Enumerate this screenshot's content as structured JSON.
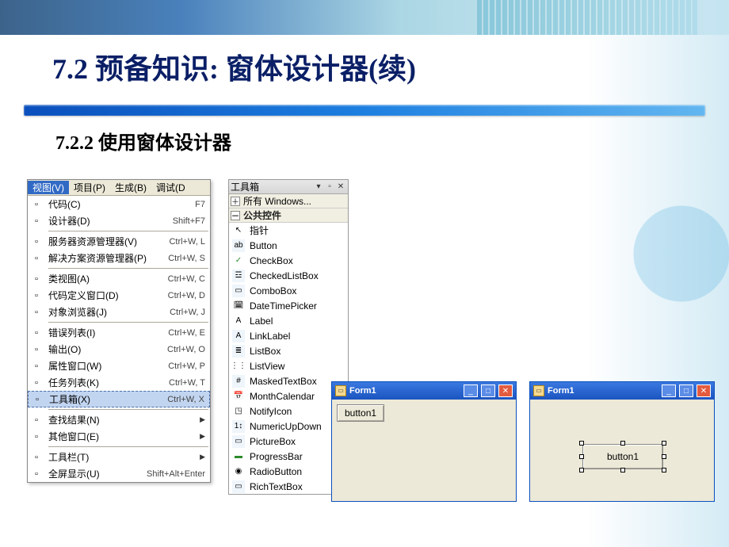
{
  "slide": {
    "title": "7.2 预备知识: 窗体设计器(续)",
    "subtitle": "7.2.2 使用窗体设计器"
  },
  "menu_bar": {
    "items": [
      "视图(V)",
      "项目(P)",
      "生成(B)",
      "调试(D"
    ],
    "active_index": 0
  },
  "view_menu": [
    {
      "icon": "code-icon",
      "label": "代码(C)",
      "shortcut": "F7"
    },
    {
      "icon": "designer-icon",
      "label": "设计器(D)",
      "shortcut": "Shift+F7"
    },
    {
      "sep": true
    },
    {
      "icon": "server-explorer-icon",
      "label": "服务器资源管理器(V)",
      "shortcut": "Ctrl+W, L"
    },
    {
      "icon": "solution-explorer-icon",
      "label": "解决方案资源管理器(P)",
      "shortcut": "Ctrl+W, S"
    },
    {
      "sep": true
    },
    {
      "icon": "class-view-icon",
      "label": "类视图(A)",
      "shortcut": "Ctrl+W, C"
    },
    {
      "icon": "code-def-icon",
      "label": "代码定义窗口(D)",
      "shortcut": "Ctrl+W, D"
    },
    {
      "icon": "object-browser-icon",
      "label": "对象浏览器(J)",
      "shortcut": "Ctrl+W, J"
    },
    {
      "sep": true
    },
    {
      "icon": "error-list-icon",
      "label": "错误列表(I)",
      "shortcut": "Ctrl+W, E"
    },
    {
      "icon": "output-icon",
      "label": "输出(O)",
      "shortcut": "Ctrl+W, O"
    },
    {
      "icon": "properties-icon",
      "label": "属性窗口(W)",
      "shortcut": "Ctrl+W, P"
    },
    {
      "icon": "task-list-icon",
      "label": "任务列表(K)",
      "shortcut": "Ctrl+W, T"
    },
    {
      "icon": "toolbox-icon",
      "label": "工具箱(X)",
      "shortcut": "Ctrl+W, X",
      "selected": true
    },
    {
      "sep": true
    },
    {
      "icon": "find-results-icon",
      "label": "查找结果(N)",
      "sub": true
    },
    {
      "icon": "other-windows-icon",
      "label": "其他窗口(E)",
      "sub": true
    },
    {
      "sep": true
    },
    {
      "icon": "toolbars-icon",
      "label": "工具栏(T)",
      "sub": true
    },
    {
      "icon": "fullscreen-icon",
      "label": "全屏显示(U)",
      "shortcut": "Shift+Alt+Enter"
    }
  ],
  "toolbox": {
    "title": "工具箱",
    "header_buttons": [
      "▾",
      "▫",
      "✕"
    ],
    "categories": [
      {
        "expand": "＋",
        "label": "所有 Windows..."
      },
      {
        "expand": "－",
        "label": "公共控件",
        "expanded": true
      }
    ],
    "items": [
      {
        "icon": "pointer-icon",
        "glyph": "↖",
        "label": "指针"
      },
      {
        "icon": "button-icon",
        "glyph": "ab",
        "label": "Button",
        "cls": "sq"
      },
      {
        "icon": "checkbox-icon",
        "glyph": "✓",
        "label": "CheckBox",
        "cls": "grn"
      },
      {
        "icon": "checkedlistbox-icon",
        "glyph": "☲",
        "label": "CheckedListBox",
        "cls": "sq"
      },
      {
        "icon": "combobox-icon",
        "glyph": "▭",
        "label": "ComboBox",
        "cls": "sq"
      },
      {
        "icon": "datetimepicker-icon",
        "glyph": "🗓",
        "label": "DateTimePicker"
      },
      {
        "icon": "label-icon",
        "glyph": "A",
        "label": "Label"
      },
      {
        "icon": "linklabel-icon",
        "glyph": "A",
        "label": "LinkLabel",
        "cls": "sq"
      },
      {
        "icon": "listbox-icon",
        "glyph": "≣",
        "label": "ListBox",
        "cls": "sq"
      },
      {
        "icon": "listview-icon",
        "glyph": "⋮⋮",
        "label": "ListView"
      },
      {
        "icon": "maskedtextbox-icon",
        "glyph": "#",
        "label": "MaskedTextBox",
        "cls": "sq"
      },
      {
        "icon": "monthcalendar-icon",
        "glyph": "📅",
        "label": "MonthCalendar"
      },
      {
        "icon": "notifyicon-icon",
        "glyph": "◳",
        "label": "NotifyIcon"
      },
      {
        "icon": "numericupdown-icon",
        "glyph": "1↕",
        "label": "NumericUpDown",
        "cls": "sq"
      },
      {
        "icon": "picturebox-icon",
        "glyph": "▭",
        "label": "PictureBox",
        "cls": "sq"
      },
      {
        "icon": "progressbar-icon",
        "glyph": "▬",
        "label": "ProgressBar",
        "cls": "grn"
      },
      {
        "icon": "radiobutton-icon",
        "glyph": "◉",
        "label": "RadioButton"
      },
      {
        "icon": "richtextbox-icon",
        "glyph": "▭",
        "label": "RichTextBox",
        "cls": "sq"
      }
    ]
  },
  "form1a": {
    "title": "Form1",
    "button_label": "button1"
  },
  "form1b": {
    "title": "Form1",
    "button_label": "button1"
  }
}
